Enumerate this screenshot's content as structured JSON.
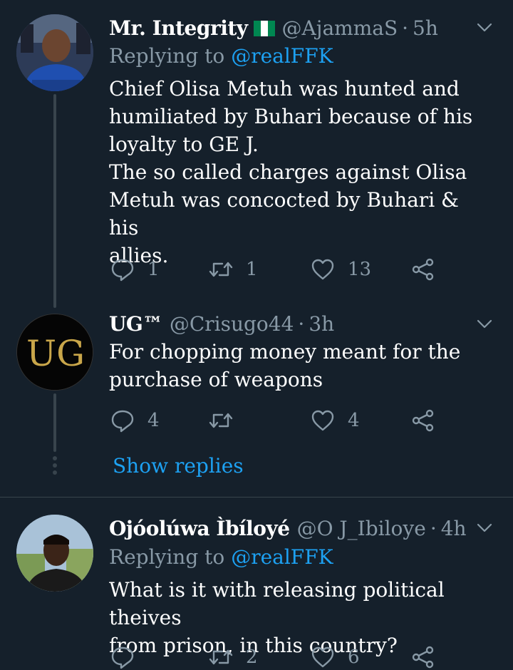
{
  "tweets": [
    {
      "name": "Mr. Integrity",
      "flag_colors": [
        "#008751",
        "#ffffff",
        "#008751"
      ],
      "handle": "@AjammaS",
      "separator": "·",
      "time": "5h",
      "replying_prefix": "Replying to",
      "replying_to": "@realFFK",
      "body": "Chief Olisa Metuh was hunted and\nhumiliated by Buhari because of his\nloyalty to GE J.\nThe so called charges against Olisa\nMetuh was concocted by Buhari & his\nallies.",
      "replies": "1",
      "retweets": "1",
      "likes": "13"
    },
    {
      "name": "UG™",
      "handle": "@Crisugo44",
      "separator": "·",
      "time": "3h",
      "avatar_text": "UG",
      "body": "For chopping money meant for the\npurchase of weapons",
      "replies": "4",
      "retweets": "",
      "likes": "4"
    },
    {
      "name": "Ojóolúwa Ìbíloyé",
      "handle": "@O J_Ibiloye",
      "separator": "·",
      "time": "4h",
      "replying_prefix": "Replying to",
      "replying_to": "@realFFK",
      "body": "What is it with releasing political theives\nfrom prison, in this country?",
      "replies": "",
      "retweets": "2",
      "likes": "6"
    }
  ],
  "show_replies_label": "Show replies",
  "colors": {
    "background": "#15202b",
    "secondary_text": "#8899a6",
    "accent": "#1da1f2",
    "thread_line": "#38444d"
  },
  "icons": [
    "reply-icon",
    "retweet-icon",
    "like-icon",
    "share-icon",
    "chevron-down-icon"
  ]
}
